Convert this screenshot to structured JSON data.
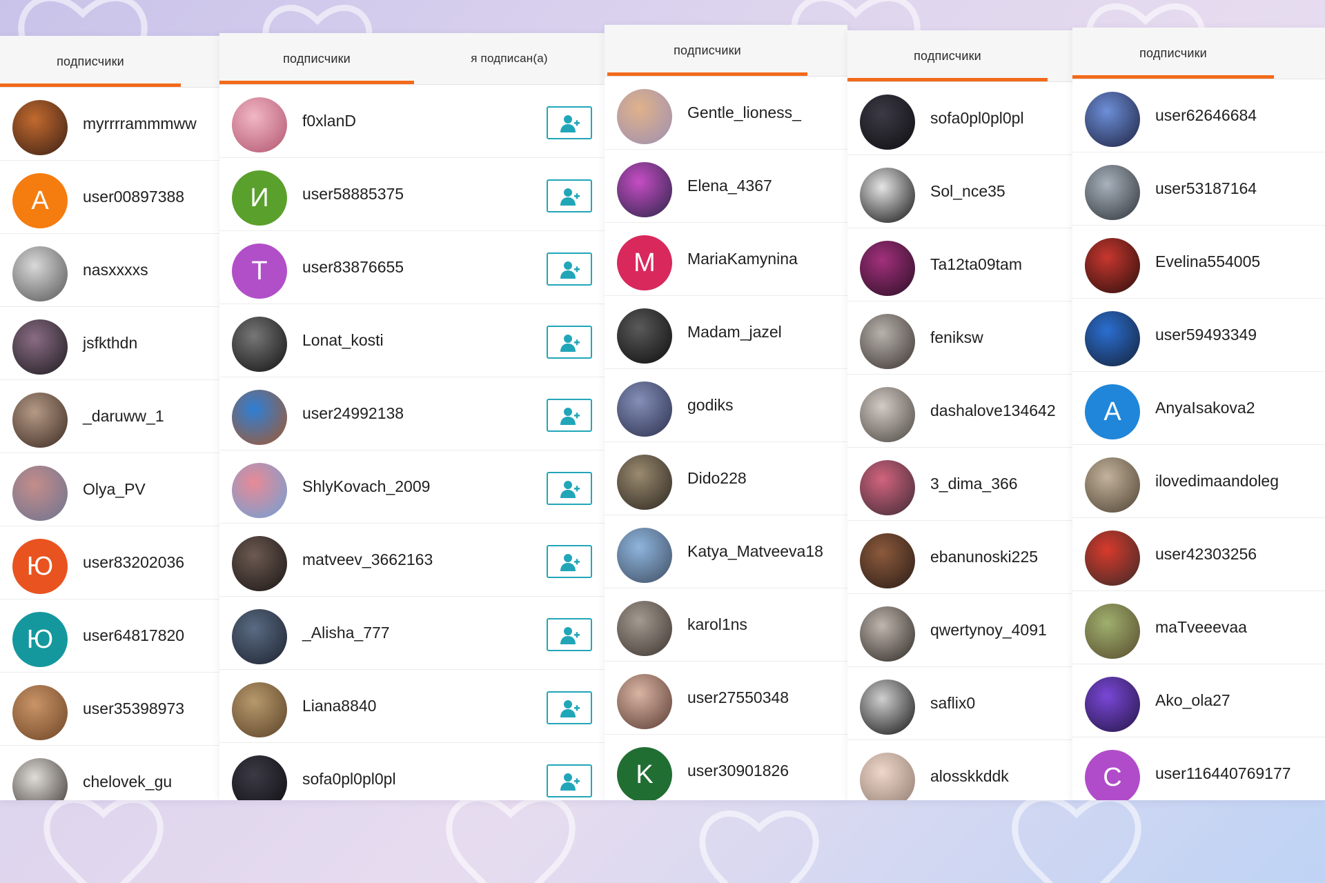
{
  "panels": [
    {
      "tabs": [
        {
          "label": "подписчики",
          "active": true
        }
      ],
      "items": [
        {
          "name": "myrrrrammmww",
          "avatar": {
            "type": "photo",
            "colors": [
              "#c26a2e",
              "#3a2015"
            ]
          }
        },
        {
          "name": "user00897388",
          "avatar": {
            "type": "letter",
            "letter": "A",
            "color": "#f57c0f"
          }
        },
        {
          "name": "nasxxxxs",
          "avatar": {
            "type": "photo",
            "colors": [
              "#d9d9d9",
              "#555"
            ]
          }
        },
        {
          "name": "jsfkthdn",
          "avatar": {
            "type": "photo",
            "colors": [
              "#8a6c84",
              "#1d1b1f"
            ]
          }
        },
        {
          "name": "_daruww_1",
          "avatar": {
            "type": "photo",
            "colors": [
              "#b59a86",
              "#3b2a22"
            ]
          }
        },
        {
          "name": "Olya_PV",
          "avatar": {
            "type": "photo",
            "colors": [
              "#c48d8a",
              "#6c7391"
            ]
          }
        },
        {
          "name": "user83202036",
          "avatar": {
            "type": "letter",
            "letter": "Ю",
            "color": "#e85320"
          }
        },
        {
          "name": "user64817820",
          "avatar": {
            "type": "letter",
            "letter": "Ю",
            "color": "#14989e"
          }
        },
        {
          "name": "user35398973",
          "avatar": {
            "type": "photo",
            "colors": [
              "#c99467",
              "#6e4526"
            ]
          }
        },
        {
          "name": "chelovek_gu",
          "avatar": {
            "type": "photo",
            "colors": [
              "#e0ddd8",
              "#3a3330"
            ]
          }
        }
      ]
    },
    {
      "tabs": [
        {
          "label": "подписчики",
          "active": true
        },
        {
          "label": "я подписан(а)",
          "active": false
        }
      ],
      "items": [
        {
          "name": "f0xlanD",
          "avatar": {
            "type": "photo",
            "colors": [
              "#f1b6c4",
              "#b1556f"
            ]
          }
        },
        {
          "name": "user58885375",
          "avatar": {
            "type": "letter",
            "letter": "И",
            "color": "#5aa02c"
          }
        },
        {
          "name": "user83876655",
          "avatar": {
            "type": "letter",
            "letter": "T",
            "color": "#b14fc9"
          }
        },
        {
          "name": "Lonat_kosti",
          "avatar": {
            "type": "photo",
            "colors": [
              "#777",
              "#111"
            ]
          }
        },
        {
          "name": "user24992138",
          "avatar": {
            "type": "photo",
            "colors": [
              "#2f7fd6",
              "#a5582b"
            ]
          }
        },
        {
          "name": "ShlyKovach_2009",
          "avatar": {
            "type": "photo",
            "colors": [
              "#e88a96",
              "#6ea0d6"
            ]
          }
        },
        {
          "name": "matveev_3662163",
          "avatar": {
            "type": "photo",
            "colors": [
              "#6d5a52",
              "#1a1514"
            ]
          }
        },
        {
          "name": "_Alisha_777",
          "avatar": {
            "type": "photo",
            "colors": [
              "#5a6b82",
              "#1c2230"
            ]
          }
        },
        {
          "name": "Liana8840",
          "avatar": {
            "type": "photo",
            "colors": [
              "#b7996c",
              "#5a4227"
            ]
          }
        },
        {
          "name": "sofa0pl0pl0pl",
          "avatar": {
            "type": "photo",
            "colors": [
              "#3c3a44",
              "#0e0d12"
            ]
          }
        }
      ]
    },
    {
      "tabs": [
        {
          "label": "подписчики",
          "active": true
        }
      ],
      "items": [
        {
          "name": "Gentle_lioness_",
          "avatar": {
            "type": "photo",
            "colors": [
              "#e0b28a",
              "#9d8fb2"
            ]
          }
        },
        {
          "name": "Elena_4367",
          "avatar": {
            "type": "photo",
            "colors": [
              "#c64dc4",
              "#2a2548"
            ]
          }
        },
        {
          "name": "MariaKamynina",
          "avatar": {
            "type": "letter",
            "letter": "M",
            "color": "#d8285c"
          }
        },
        {
          "name": "Madam_jazel",
          "avatar": {
            "type": "photo",
            "colors": [
              "#5a5a5a",
              "#0d0d0d"
            ]
          }
        },
        {
          "name": "godiks",
          "avatar": {
            "type": "photo",
            "colors": [
              "#8490b8",
              "#2b2f4d"
            ]
          }
        },
        {
          "name": "Dido228",
          "avatar": {
            "type": "photo",
            "colors": [
              "#9a8a6f",
              "#2c2720"
            ]
          }
        },
        {
          "name": "Katya_Matveeva18",
          "avatar": {
            "type": "photo",
            "colors": [
              "#8fb5dd",
              "#3e4d62"
            ]
          }
        },
        {
          "name": "karol1ns",
          "avatar": {
            "type": "photo",
            "colors": [
              "#a39a90",
              "#3d3430"
            ]
          }
        },
        {
          "name": "user27550348",
          "avatar": {
            "type": "photo",
            "colors": [
              "#d9b4a3",
              "#5a3c33"
            ]
          }
        },
        {
          "name": "user30901826",
          "avatar": {
            "type": "letter",
            "letter": "K",
            "color": "#216e33"
          }
        }
      ]
    },
    {
      "tabs": [
        {
          "label": "подписчики",
          "active": true
        }
      ],
      "items": [
        {
          "name": "sofa0pl0pl0pl",
          "avatar": {
            "type": "photo",
            "colors": [
              "#3c3a44",
              "#0e0d12"
            ]
          }
        },
        {
          "name": "Sol_nce35",
          "avatar": {
            "type": "photo",
            "colors": [
              "#e5e5e5",
              "#111"
            ]
          }
        },
        {
          "name": "Ta12ta09tam",
          "avatar": {
            "type": "photo",
            "colors": [
              "#a2307c",
              "#2a0f24"
            ]
          }
        },
        {
          "name": "feniksw",
          "avatar": {
            "type": "photo",
            "colors": [
              "#b8b2ad",
              "#3a3330"
            ]
          }
        },
        {
          "name": "dashalove134642",
          "avatar": {
            "type": "photo",
            "colors": [
              "#d2cbc4",
              "#4b4541"
            ]
          }
        },
        {
          "name": "3_dima_366",
          "avatar": {
            "type": "photo",
            "colors": [
              "#d2647e",
              "#3d2a35"
            ]
          }
        },
        {
          "name": "ebanunoski225",
          "avatar": {
            "type": "photo",
            "colors": [
              "#8c5a3c",
              "#2a1c17"
            ]
          }
        },
        {
          "name": "qwertynoy_4091",
          "avatar": {
            "type": "photo",
            "colors": [
              "#bfb6ad",
              "#2d2825"
            ]
          }
        },
        {
          "name": "saflix0",
          "avatar": {
            "type": "photo",
            "colors": [
              "#cfcfcf",
              "#141414"
            ]
          }
        },
        {
          "name": "alosskkddk",
          "avatar": {
            "type": "photo",
            "colors": [
              "#efd7c9",
              "#8e7a70"
            ]
          }
        }
      ]
    },
    {
      "tabs": [
        {
          "label": "подписчики",
          "active": true
        }
      ],
      "items": [
        {
          "name": "user62646684",
          "avatar": {
            "type": "photo",
            "colors": [
              "#6d8fd8",
              "#1d2240"
            ]
          }
        },
        {
          "name": "user53187164",
          "avatar": {
            "type": "photo",
            "colors": [
              "#a8b2bc",
              "#2d3238"
            ]
          }
        },
        {
          "name": "Evelina554005",
          "avatar": {
            "type": "photo",
            "colors": [
              "#c7372f",
              "#2b0f0c"
            ]
          }
        },
        {
          "name": "user59493349",
          "avatar": {
            "type": "photo",
            "colors": [
              "#2b6fd1",
              "#152138"
            ]
          }
        },
        {
          "name": "AnyaIsakova2",
          "avatar": {
            "type": "letter",
            "letter": "A",
            "color": "#1f86d9"
          }
        },
        {
          "name": "ilovedimaandoleg",
          "avatar": {
            "type": "photo",
            "colors": [
              "#c3b39d",
              "#4f4232"
            ]
          }
        },
        {
          "name": "user42303256",
          "avatar": {
            "type": "photo",
            "colors": [
              "#d83a2c",
              "#3b2a28"
            ]
          }
        },
        {
          "name": "maTveeevaa",
          "avatar": {
            "type": "photo",
            "colors": [
              "#9fb06e",
              "#574a2d"
            ]
          }
        },
        {
          "name": "Ako_ola27",
          "avatar": {
            "type": "photo",
            "colors": [
              "#7a47d6",
              "#241646"
            ]
          }
        },
        {
          "name": "user116440769177",
          "avatar": {
            "type": "letter",
            "letter": "C",
            "color": "#b04cc9"
          }
        }
      ]
    }
  ]
}
